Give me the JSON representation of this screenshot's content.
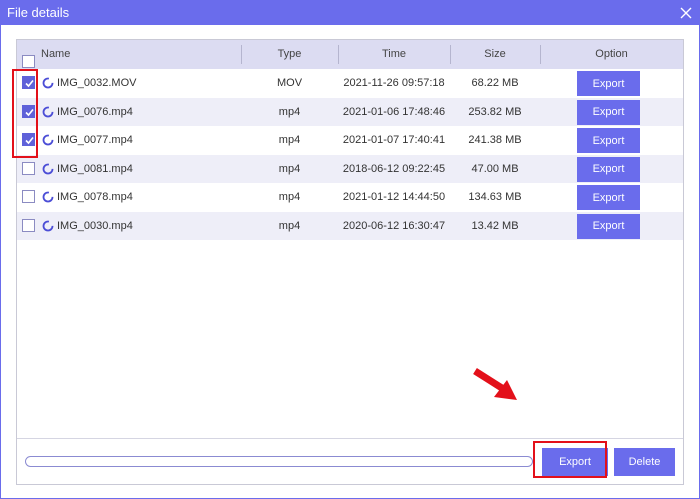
{
  "window": {
    "title": "File details"
  },
  "table": {
    "columns": [
      "Name",
      "Type",
      "Time",
      "Size",
      "Option"
    ],
    "rows": [
      {
        "name": "IMG_0032.MOV",
        "type": "MOV",
        "time": "2021-11-26 09:57:18",
        "size": "68.22 MB",
        "checked": true,
        "option": "Export"
      },
      {
        "name": "IMG_0076.mp4",
        "type": "mp4",
        "time": "2021-01-06 17:48:46",
        "size": "253.82 MB",
        "checked": true,
        "option": "Export"
      },
      {
        "name": "IMG_0077.mp4",
        "type": "mp4",
        "time": "2021-01-07 17:40:41",
        "size": "241.38 MB",
        "checked": true,
        "option": "Export"
      },
      {
        "name": "IMG_0081.mp4",
        "type": "mp4",
        "time": "2018-06-12 09:22:45",
        "size": "47.00 MB",
        "checked": false,
        "option": "Export"
      },
      {
        "name": "IMG_0078.mp4",
        "type": "mp4",
        "time": "2021-01-12 14:44:50",
        "size": "134.63 MB",
        "checked": false,
        "option": "Export"
      },
      {
        "name": "IMG_0030.mp4",
        "type": "mp4",
        "time": "2020-06-12 16:30:47",
        "size": "13.42 MB",
        "checked": false,
        "option": "Export"
      }
    ]
  },
  "footer": {
    "progress": 0,
    "export_label": "Export",
    "delete_label": "Delete"
  },
  "colors": {
    "accent": "#6a6cec",
    "highlight": "#e3101a"
  }
}
